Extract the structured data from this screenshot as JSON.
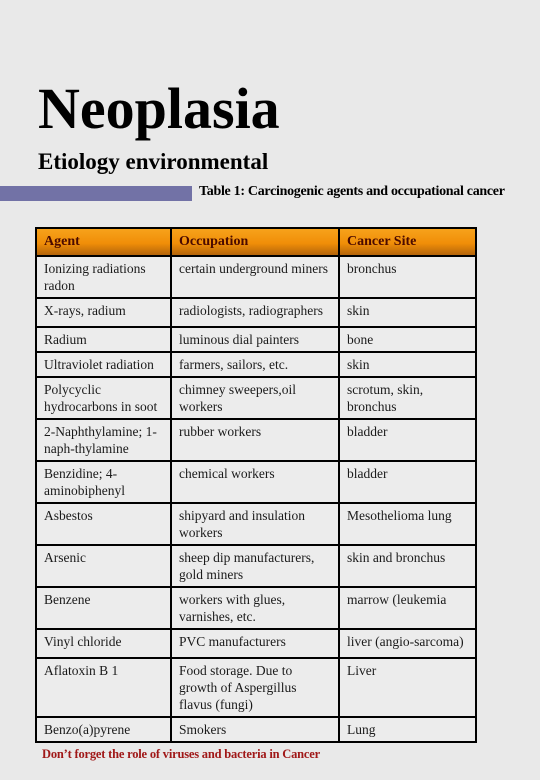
{
  "page": {
    "title": "Neoplasia",
    "subtitle": "Etiology environmental",
    "caption": "Table 1: Carcinogenic agents and occupational cancer",
    "footer_note": "Don’t forget the role of viruses and bacteria in Cancer"
  },
  "colors": {
    "accent_bar": "#7272a6",
    "header_bg": "#f08e08",
    "header_text": "#4a0a00",
    "footer_text": "#a01818",
    "background": "#e9e9e9"
  },
  "table": {
    "headers": [
      "Agent",
      "Occupation",
      "Cancer Site"
    ],
    "rows": [
      [
        "Ionizing radiations radon",
        "certain underground miners",
        "bronchus"
      ],
      [
        "X-rays, radium",
        "radiologists, radiographers",
        "skin"
      ],
      [
        "Radium",
        "luminous dial painters",
        "bone"
      ],
      [
        "Ultraviolet radiation",
        "farmers, sailors, etc.",
        "skin"
      ],
      [
        "Polycyclic hydrocarbons in soot",
        "chimney sweepers,oil workers",
        "scrotum, skin, bronchus"
      ],
      [
        "2-Naphthylamine; 1-naph-thylamine",
        "rubber workers",
        "bladder"
      ],
      [
        "Benzidine; 4-aminobiphenyl",
        "chemical workers",
        "bladder"
      ],
      [
        "Asbestos",
        "shipyard and insulation workers",
        "Mesothelioma lung"
      ],
      [
        "Arsenic",
        "sheep dip manufacturers, gold miners",
        "skin and bronchus"
      ],
      [
        "Benzene",
        "workers with glues, varnishes, etc.",
        "marrow (leukemia"
      ],
      [
        "Vinyl chloride",
        "PVC manufacturers",
        "liver (angio-sarcoma)"
      ],
      [
        "Aflatoxin B 1",
        "Food storage. Due to growth of Aspergillus flavus (fungi)",
        "Liver"
      ],
      [
        "Benzo(a)pyrene",
        "Smokers",
        "Lung"
      ]
    ]
  }
}
